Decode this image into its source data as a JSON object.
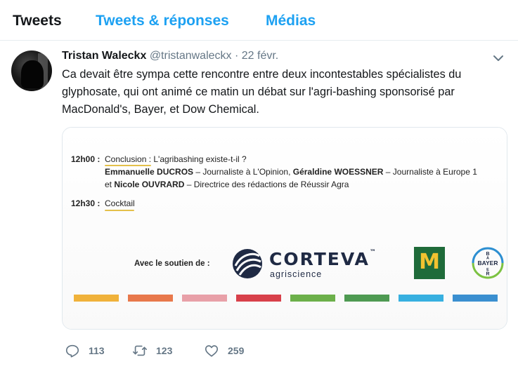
{
  "tabs": [
    {
      "label": "Tweets"
    },
    {
      "label": "Tweets & réponses"
    },
    {
      "label": "Médias"
    }
  ],
  "tweet": {
    "name": "Tristan Waleckx",
    "handle": "@tristanwaleckx",
    "separator": "·",
    "date": "22 févr.",
    "text": "Ca devait être sympa cette rencontre entre deux incontestables spécialistes du glyphosate, qui ont animé ce matin un débat sur l'agri-bashing sponsorisé par MacDonald's, Bayer, et Dow Chemical.",
    "actions": {
      "replies": "113",
      "retweets": "123",
      "likes": "259"
    }
  },
  "card": {
    "time1": "12h00 :",
    "conclusion_label": "Conclusion",
    "conclusion_text": " : L'agribashing existe-t-il ?",
    "speaker1_name": "Emmanuelle DUCROS",
    "speaker1_role": " – Journaliste à L'Opinion, ",
    "speaker2_name": "Géraldine WOESSNER",
    "speaker2_role": " – Journaliste à Europe 1",
    "and": "et ",
    "speaker3_name": "Nicole OUVRARD",
    "speaker3_role": " – Directrice des rédactions de Réussir Agra",
    "time2": "12h30 :",
    "cocktail": "Cocktail",
    "sponsor_label": "Avec le soutien de :",
    "corteva_word": "CORTEVA",
    "corteva_tm": "™",
    "corteva_sub": "agriscience",
    "mcd_letter": "M",
    "bayer_text": "BAYER",
    "stripe_colors": [
      "#f0b23a",
      "#e8784b",
      "#e8a0a8",
      "#d8404a",
      "#6cb04a",
      "#4e9a52",
      "#37b0e0",
      "#3a8fd0"
    ]
  },
  "colors": {
    "accent": "#1da1f2",
    "text": "#14171a",
    "muted": "#657786",
    "corteva": "#1f2a44",
    "mcd_green": "#1f6b3a",
    "mcd_yellow": "#f2c230",
    "bayer_blue": "#2d8fd1",
    "bayer_green": "#7cc242"
  },
  "icons": [
    "chevron-down-icon",
    "reply-icon",
    "retweet-icon",
    "like-icon"
  ]
}
